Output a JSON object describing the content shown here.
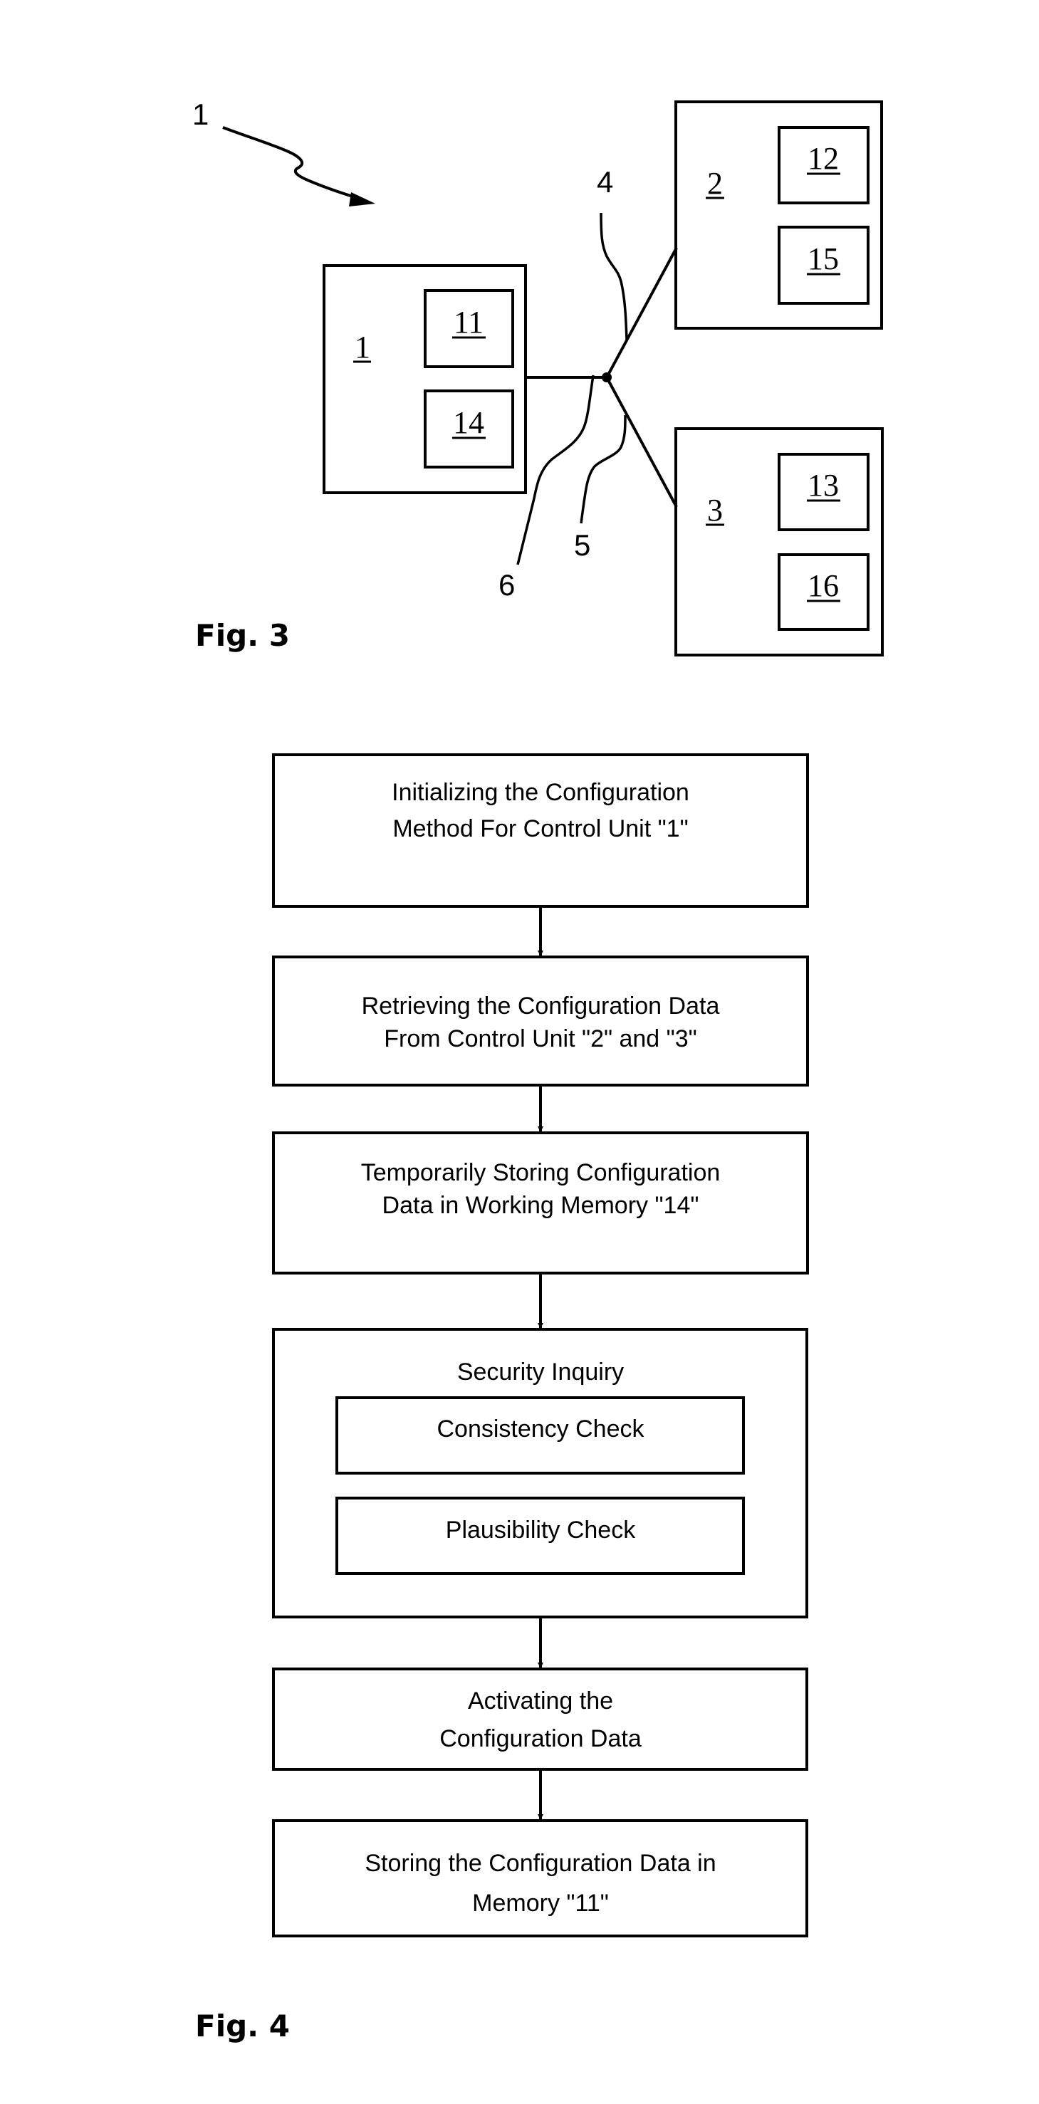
{
  "figure3": {
    "caption": "Fig. 3",
    "system_ref": "1",
    "control_units": [
      {
        "ref": "1",
        "memory_ref": "11",
        "working_memory_ref": "14"
      },
      {
        "ref": "2",
        "memory_ref": "12",
        "working_memory_ref": "15"
      },
      {
        "ref": "3",
        "memory_ref": "13",
        "working_memory_ref": "16"
      }
    ],
    "connection_refs": {
      "to_unit_2": "4",
      "to_unit_3": "5",
      "to_unit_1": "6"
    }
  },
  "figure4": {
    "caption": "Fig. 4",
    "steps": [
      {
        "lines": [
          "Initializing the Configuration",
          "Method For Control Unit \"1\""
        ]
      },
      {
        "lines": [
          "Retrieving the Configuration Data",
          "From Control Unit \"2\" and \"3\""
        ]
      },
      {
        "lines": [
          "Temporarily Storing Configuration",
          "Data in Working Memory \"14\""
        ]
      },
      {
        "title": "Security Inquiry",
        "substeps": [
          "Consistency Check",
          "Plausibility Check"
        ]
      },
      {
        "lines": [
          "Activating the",
          "Configuration Data"
        ]
      },
      {
        "lines": [
          "Storing the Configuration Data in",
          "Memory \"11\""
        ]
      }
    ]
  }
}
